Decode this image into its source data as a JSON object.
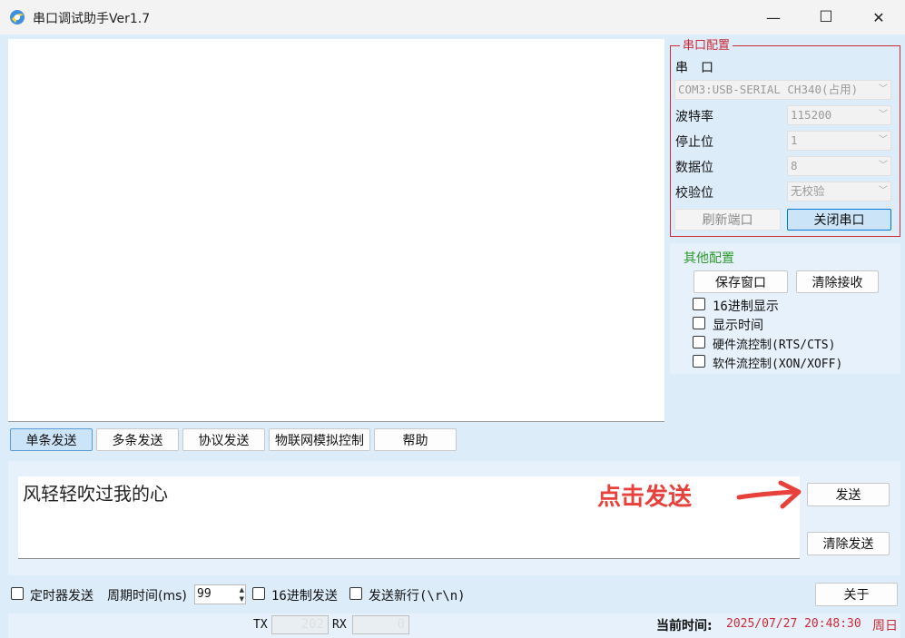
{
  "window": {
    "title": "串口调试助手Ver1.7",
    "minimize_icon": "—",
    "maximize_icon": "☐",
    "close_icon": "✕"
  },
  "serial_config": {
    "title": "串口配置",
    "port_label": "串　口",
    "port_value": "COM3:USB-SERIAL CH340(占用)",
    "baud_label": "波特率",
    "baud_value": "115200",
    "stop_label": "停止位",
    "stop_value": "1",
    "data_label": "数据位",
    "data_value": "8",
    "parity_label": "校验位",
    "parity_value": "无校验",
    "refresh_button": "刷新端口",
    "close_port_button": "关闭串口"
  },
  "other_config": {
    "title": "其他配置",
    "save_window_button": "保存窗口",
    "clear_receive_button": "清除接收",
    "options": [
      {
        "label": "16进制显示",
        "checked": false
      },
      {
        "label": "显示时间",
        "checked": false
      },
      {
        "label": "硬件流控制(RTS/CTS)",
        "checked": false
      },
      {
        "label": "软件流控制(XON/XOFF)",
        "checked": false
      }
    ]
  },
  "tabs": [
    "单条发送",
    "多条发送",
    "协议发送",
    "物联网模拟控制",
    "帮助"
  ],
  "active_tab": 0,
  "send": {
    "text": "风轻轻吹过我的心",
    "annotation": "点击发送",
    "send_button": "发送",
    "clear_send_button": "清除发送"
  },
  "bottom": {
    "timer_send_label": "定时器发送",
    "period_label": "周期时间(ms)",
    "period_value": "99",
    "hex_send_label": "16进制发送",
    "newline_label": "发送新行(\\r\\n)",
    "about_button": "关于"
  },
  "status": {
    "tx_label": "TX",
    "tx_value": "202",
    "rx_label": "RX",
    "rx_value": "0",
    "time_label": "当前时间:",
    "time_value": "2025/07/27 20:48:30",
    "weekday": "周日"
  },
  "colors": {
    "accent_red": "#cc2a36",
    "annotation_red": "#e8403a",
    "green_title": "#2e9a2e",
    "time_red": "#cc2a36",
    "background": "#dcecf9"
  },
  "icons": {
    "app": "app-logo-icon",
    "combo_arrow": "chevron-down-icon",
    "spin_up": "▲",
    "spin_down": "▼"
  }
}
